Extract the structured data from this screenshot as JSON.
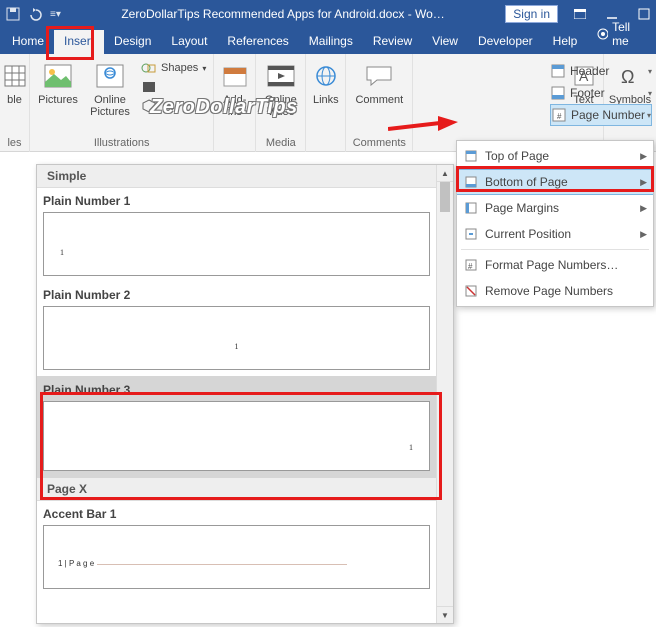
{
  "titlebar": {
    "doc_title": "ZeroDollarTips Recommended Apps for Android.docx - Wo…",
    "signin": "Sign in"
  },
  "tabs": {
    "items": [
      "Home",
      "Insert",
      "Design",
      "Layout",
      "References",
      "Mailings",
      "Review",
      "View",
      "Developer",
      "Help"
    ],
    "tellme": "Tell me",
    "active": "Insert"
  },
  "ribbon": {
    "tables": {
      "label": "les",
      "btn": "ble"
    },
    "illustrations": {
      "label": "Illustrations",
      "pictures": "Pictures",
      "online_pictures": "Online\nPictures",
      "shapes": "Shapes"
    },
    "addins": {
      "label": "",
      "btn": "Add-\nins"
    },
    "media": {
      "label": "Media",
      "btn": "Online\nVideo"
    },
    "links": {
      "btn": "Links"
    },
    "comments": {
      "label": "Comments",
      "btn": "Comment"
    },
    "headerfooter": {
      "label": "",
      "header": "Header",
      "footer": "Footer",
      "page_number": "Page Number"
    },
    "text": {
      "label": "",
      "btn": "Text"
    },
    "symbols": {
      "label": "",
      "btn": "Symbols"
    }
  },
  "dropdown": {
    "items": [
      {
        "icon": "top",
        "label": "Top of Page",
        "arrow": true
      },
      {
        "icon": "bottom",
        "label": "Bottom of Page",
        "arrow": true,
        "hover": true
      },
      {
        "icon": "margin",
        "label": "Page Margins",
        "arrow": true
      },
      {
        "icon": "current",
        "label": "Current Position",
        "arrow": true
      },
      {
        "sep": true
      },
      {
        "icon": "format",
        "label": "Format Page Numbers…"
      },
      {
        "icon": "remove",
        "label": "Remove Page Numbers"
      }
    ]
  },
  "gallery": {
    "section1": "Simple",
    "opt1": "Plain Number 1",
    "opt2": "Plain Number 2",
    "opt3": "Plain Number 3",
    "section2": "Page X",
    "opt4": "Accent Bar 1",
    "accent_sample": "1 | P a g e",
    "sample_num": "1"
  },
  "watermark": "ZeroDollarTips"
}
